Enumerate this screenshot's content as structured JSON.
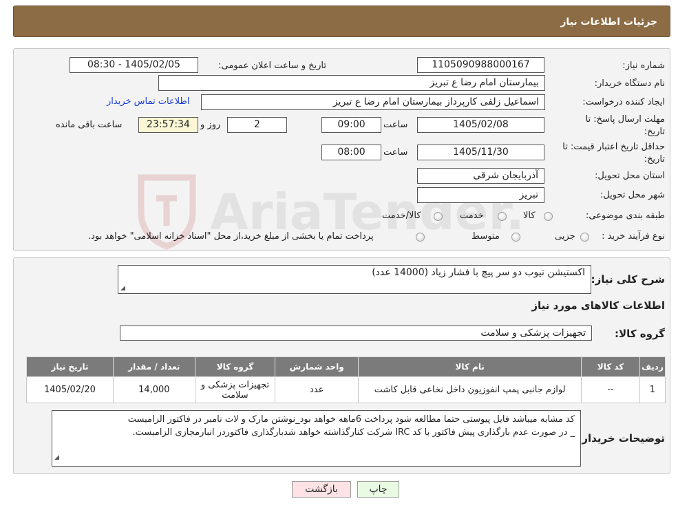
{
  "header": {
    "title": "جزئیات اطلاعات نیاز"
  },
  "form": {
    "need_number_label": "شماره نیاز:",
    "need_number": "1105090988000167",
    "announce_label": "تاریخ و ساعت اعلان عمومی:",
    "announce_value": "1405/02/05 - 08:30",
    "buyer_label": "نام دستگاه خریدار:",
    "buyer_value": "بیمارستان امام رضا  ع  تبریز",
    "creator_label": "ایجاد کننده درخواست:",
    "creator_value": "اسماعیل زلفی کارپرداز بیمارستان امام رضا  ع  تبریز",
    "contact_link": "اطلاعات تماس خریدار",
    "deadline_label_line1": "مهلت ارسال پاسخ: تا",
    "deadline_label_line2": "تاریخ:",
    "deadline_date": "1405/02/08",
    "time_label": "ساعت",
    "deadline_time": "09:00",
    "days_value": "2",
    "days_label": "روز و",
    "remaining_time": "23:57:34",
    "remaining_label": "ساعت باقی مانده",
    "validity_label_line1": "حداقل تاریخ اعتبار قیمت: تا",
    "validity_label_line2": "تاریخ:",
    "validity_date": "1405/11/30",
    "validity_time": "08:00",
    "province_label": "استان محل تحویل:",
    "province_value": "آذربایجان شرقی",
    "city_label": "شهر محل تحویل:",
    "city_value": "تبریز",
    "category_label": "طبقه بندی موضوعی:",
    "category_options": [
      "کالا",
      "خدمت",
      "کالا/خدمت"
    ],
    "process_label": "نوع فرآیند خرید :",
    "process_options": [
      "جزیی",
      "متوسط"
    ],
    "process_note": "پرداخت تمام یا بخشی از مبلغ خرید،از محل \"اسناد خزانه اسلامی\" خواهد بود."
  },
  "details": {
    "summary_label": "شرح کلی نیاز:",
    "summary_value": "اکستیشن تیوب دو سر پیچ با فشار زیاد (14000 عدد)",
    "items_title": "اطلاعات کالاهای مورد نیاز",
    "group_label": "گروه کالا:",
    "group_value": "تجهیزات پزشکی و سلامت",
    "table": {
      "headers": [
        "ردیف",
        "کد کالا",
        "نام کالا",
        "واحد شمارش",
        "گروه کالا",
        "تعداد / مقدار",
        "تاریخ نیاز"
      ],
      "rows": [
        [
          "1",
          "--",
          "لوازم جانبی پمپ انفوزیون داخل نخاعی قابل کاشت",
          "عدد",
          "تجهیزات پزشکی و سلامت",
          "14,000",
          "1405/02/20"
        ]
      ]
    },
    "buyer_notes_label": "توضیحات خریدار:",
    "buyer_notes_line1": "کد مشابه میباشد فایل پیوستی حتما مطالعه شود  پرداخت 6ماهه خواهد بود_نوشتن مارک و لات نامبر در فاکتور الزامیست",
    "buyer_notes_line2": "_  در صورت عدم بارگذاری پیش فاکتور با کد IRC  شرکت کنارگذاشته خواهد شدبارگذاری فاکتوردر انبارمجازی الزامیست."
  },
  "buttons": {
    "print": "چاپ",
    "back": "بازگشت"
  },
  "watermark": {
    "text": "AriaTender.neT"
  }
}
